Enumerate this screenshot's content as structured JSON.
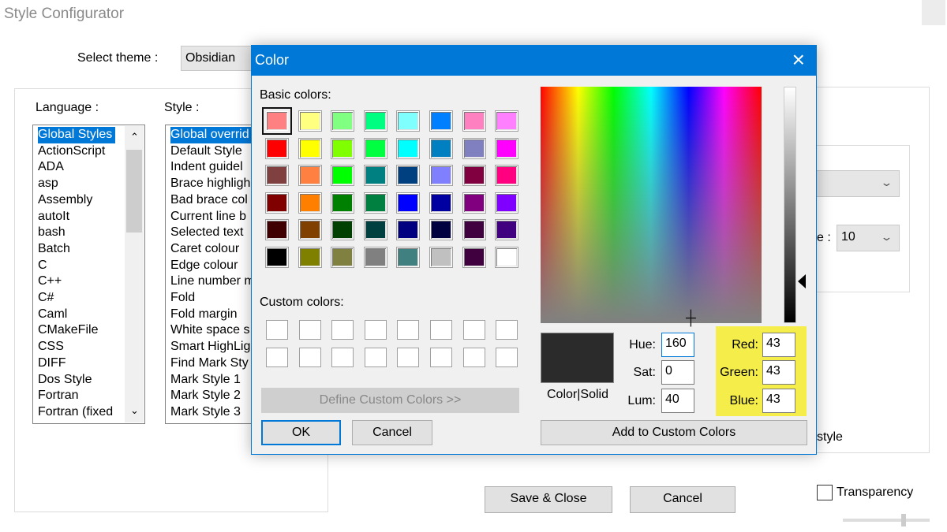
{
  "window": {
    "title": "Style Configurator"
  },
  "theme": {
    "label": "Select theme :",
    "value": "Obsidian"
  },
  "language": {
    "label": "Language :",
    "items": [
      "Global Styles",
      "ActionScript",
      "ADA",
      "asp",
      "Assembly",
      "autoIt",
      "bash",
      "Batch",
      "C",
      "C++",
      "C#",
      "Caml",
      "CMakeFile",
      "CSS",
      "DIFF",
      "Dos Style",
      "Fortran",
      "Fortran (fixed"
    ],
    "selected": 0
  },
  "style": {
    "label": "Style :",
    "items": [
      "Global overrid",
      "Default Style",
      "Indent guidel",
      "Brace highligh",
      "Bad brace col",
      "Current line b",
      "Selected text",
      "Caret colour",
      "Edge colour",
      "Line number m",
      "Fold",
      "Fold margin",
      "White space s",
      "Smart HighLig",
      "Find Mark Sty",
      "Mark Style 1",
      "Mark Style 2",
      "Mark Style 3"
    ],
    "selected": 0
  },
  "right_panel": {
    "size_label_partial": "e :",
    "size_value": "10",
    "style_partial": "style"
  },
  "bottom": {
    "save_close": "Save & Close",
    "cancel": "Cancel",
    "transparency": "Transparency",
    "transparency_checked": false
  },
  "color_dialog": {
    "title": "Color",
    "close_icon": "×",
    "basic_label": "Basic colors:",
    "basic_colors": [
      [
        "#FF8080",
        "#FFFF80",
        "#80FF80",
        "#00FF80",
        "#80FFFF",
        "#0080FF",
        "#FF80C0",
        "#FF80FF"
      ],
      [
        "#FF0000",
        "#FFFF00",
        "#80FF00",
        "#00FF40",
        "#00FFFF",
        "#0080C0",
        "#8080C0",
        "#FF00FF"
      ],
      [
        "#804040",
        "#FF8040",
        "#00FF00",
        "#008080",
        "#004080",
        "#8080FF",
        "#800040",
        "#FF0080"
      ],
      [
        "#800000",
        "#FF8000",
        "#008000",
        "#008040",
        "#0000FF",
        "#0000A0",
        "#800080",
        "#8000FF"
      ],
      [
        "#400000",
        "#804000",
        "#004000",
        "#004040",
        "#000080",
        "#000040",
        "#400040",
        "#400080"
      ],
      [
        "#000000",
        "#808000",
        "#808040",
        "#808080",
        "#408080",
        "#C0C0C0",
        "#400040",
        "#FFFFFF"
      ]
    ],
    "custom_label": "Custom colors:",
    "define_custom": "Define Custom Colors >>",
    "ok": "OK",
    "cancel": "Cancel",
    "color_solid_label": "Color|Solid",
    "current_color": "#2B2B2B",
    "hue_label": "Hue:",
    "hue": "160",
    "sat_label": "Sat:",
    "sat": "0",
    "lum_label": "Lum:",
    "lum": "40",
    "red_label": "Red:",
    "red": "43",
    "green_label": "Green:",
    "green": "43",
    "blue_label": "Blue:",
    "blue": "43",
    "add_custom": "Add to Custom Colors",
    "highlight_color": "#F5EE4A"
  }
}
